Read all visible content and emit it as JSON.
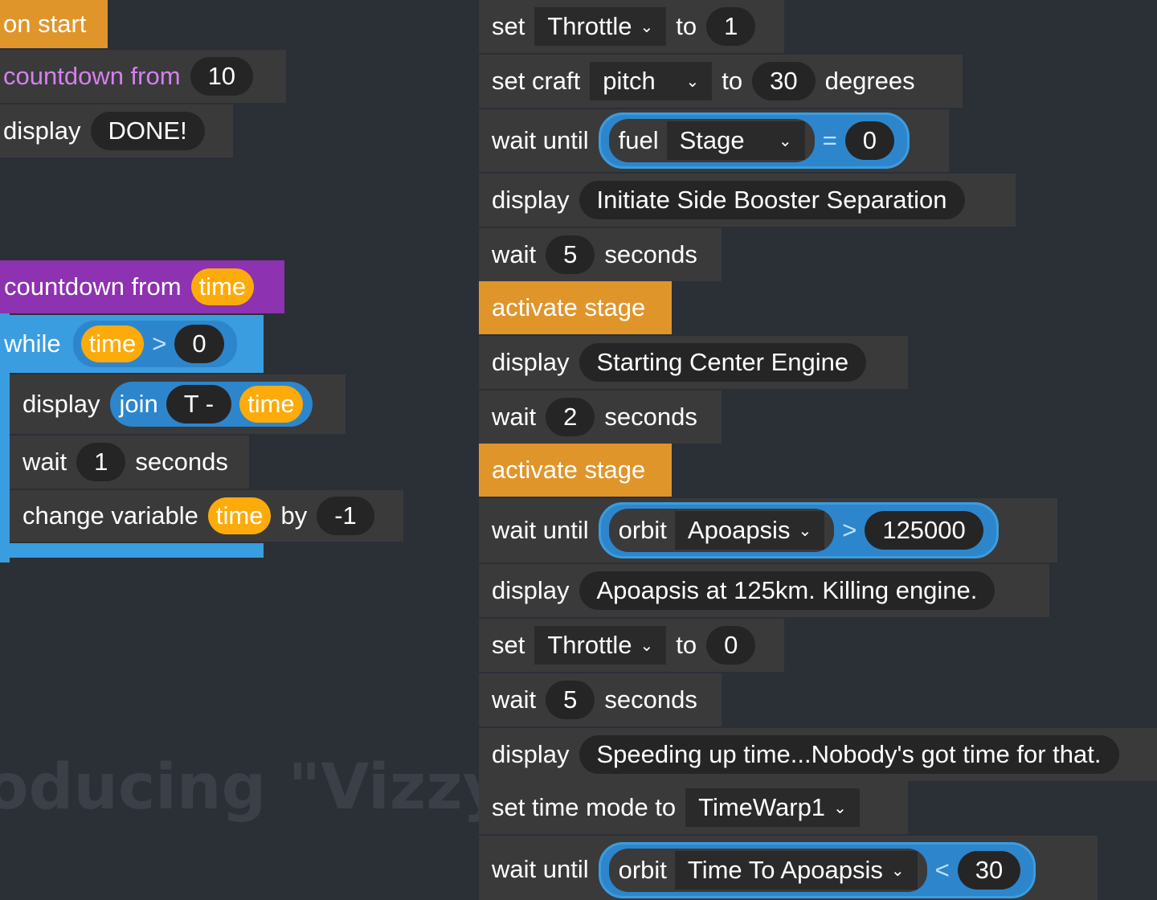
{
  "watermark": "oducing \"Vizzy\"",
  "colors": {
    "background": "#2b2f36",
    "block": "#3a3a3b",
    "event": "#e0952b",
    "custom": "#8d32b0",
    "control": "#3a9de0",
    "variable": "#fdab0a"
  },
  "left": {
    "on_start": "on start",
    "countdown_call": {
      "label": "countdown from",
      "value": "10"
    },
    "display_done": {
      "label": "display",
      "value": "DONE!"
    },
    "countdown_def": {
      "label": "countdown from",
      "param": "time"
    },
    "while": {
      "label": "while",
      "var": "time",
      "op": ">",
      "value": "0"
    },
    "display_join": {
      "label": "display",
      "join": "join",
      "text": "T -",
      "var": "time"
    },
    "wait": {
      "label": "wait",
      "value": "1",
      "unit": "seconds"
    },
    "change": {
      "label": "change variable",
      "var": "time",
      "by": "by",
      "value": "-1"
    }
  },
  "right": {
    "r1": {
      "set": "set",
      "prop": "Throttle",
      "to": "to",
      "value": "1"
    },
    "r2": {
      "set": "set craft",
      "prop": "pitch",
      "to": "to",
      "value": "30",
      "unit": "degrees"
    },
    "r3": {
      "label": "wait until",
      "cat": "fuel",
      "prop": "Stage",
      "op": "=",
      "value": "0"
    },
    "r4": {
      "label": "display",
      "value": "Initiate Side Booster Separation"
    },
    "r5": {
      "label": "wait",
      "value": "5",
      "unit": "seconds"
    },
    "r6": {
      "label": "activate stage"
    },
    "r7": {
      "label": "display",
      "value": "Starting Center Engine"
    },
    "r8": {
      "label": "wait",
      "value": "2",
      "unit": "seconds"
    },
    "r9": {
      "label": "activate stage"
    },
    "r10": {
      "label": "wait until",
      "cat": "orbit",
      "prop": "Apoapsis",
      "op": ">",
      "value": "125000"
    },
    "r11": {
      "label": "display",
      "value": "Apoapsis at 125km. Killing engine."
    },
    "r12": {
      "set": "set",
      "prop": "Throttle",
      "to": "to",
      "value": "0"
    },
    "r13": {
      "label": "wait",
      "value": "5",
      "unit": "seconds"
    },
    "r14": {
      "label": "display",
      "value": "Speeding up time...Nobody's got time for that."
    },
    "r15": {
      "label": "set time mode to",
      "prop": "TimeWarp1"
    },
    "r16": {
      "label": "wait until",
      "cat": "orbit",
      "prop": "Time To Apoapsis",
      "op": "<",
      "value": "30"
    }
  }
}
